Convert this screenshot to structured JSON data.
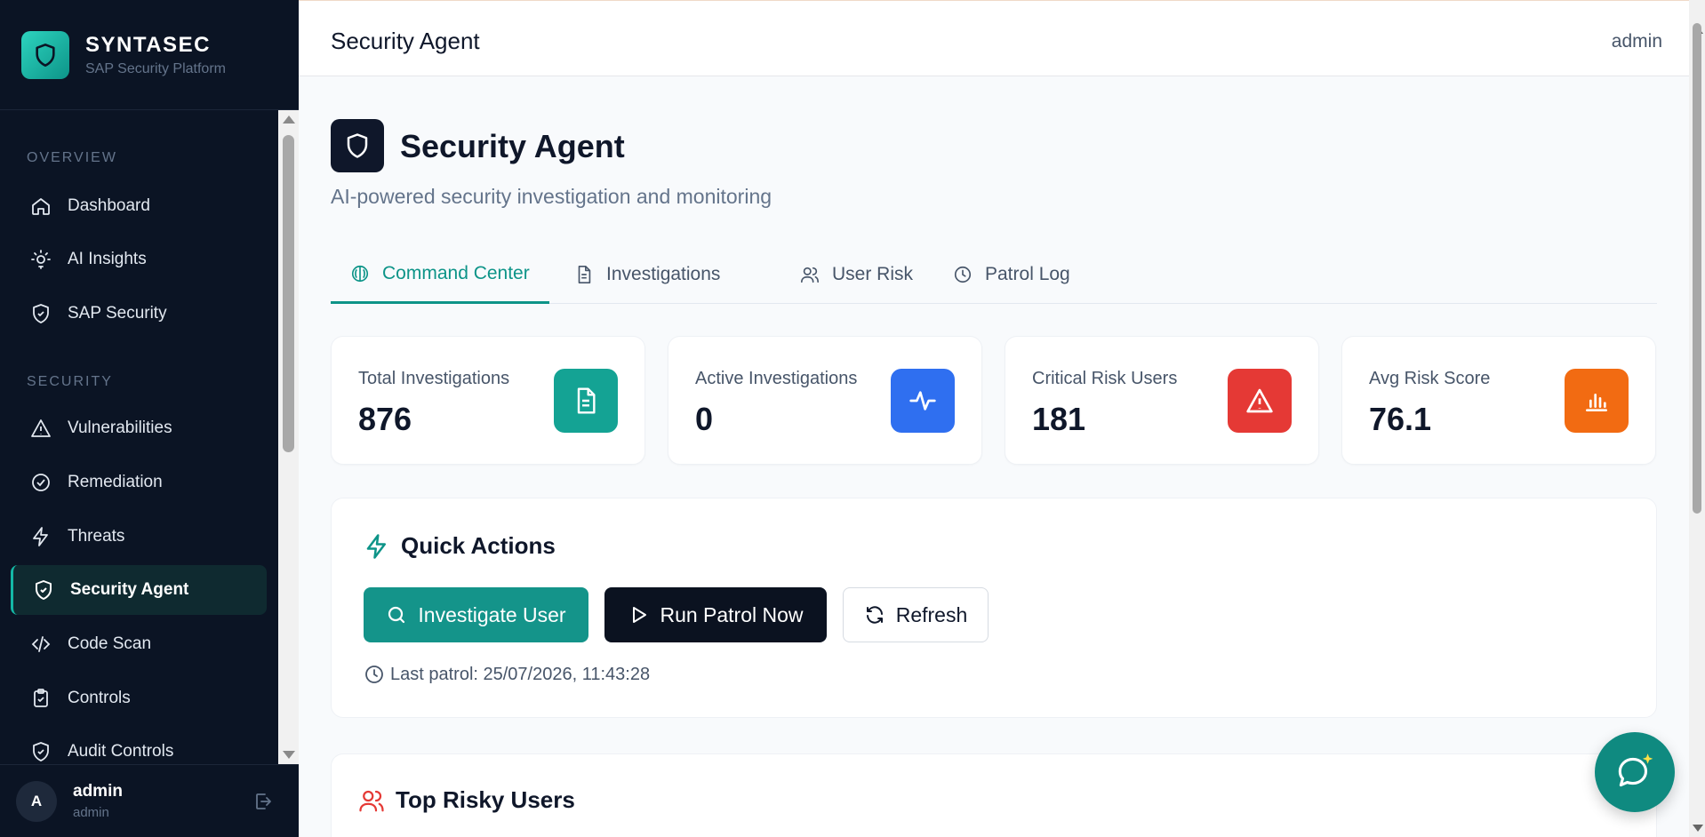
{
  "brand": {
    "name": "SYNTASEC",
    "subtitle": "SAP Security Platform"
  },
  "sidebar": {
    "sections": [
      {
        "title": "OVERVIEW"
      },
      {
        "title": "SECURITY"
      }
    ],
    "items": [
      {
        "label": "Dashboard",
        "icon": "home-icon"
      },
      {
        "label": "AI Insights",
        "icon": "lightbulb-icon"
      },
      {
        "label": "SAP Security",
        "icon": "shield-check-icon"
      },
      {
        "label": "Vulnerabilities",
        "icon": "warning-triangle-icon"
      },
      {
        "label": "Remediation",
        "icon": "check-circle-icon"
      },
      {
        "label": "Threats",
        "icon": "lightning-icon"
      },
      {
        "label": "Security Agent",
        "icon": "shield-check-icon",
        "active": true
      },
      {
        "label": "Code Scan",
        "icon": "code-icon"
      },
      {
        "label": "Controls",
        "icon": "clipboard-check-icon"
      },
      {
        "label": "Audit Controls",
        "icon": "shield-check-icon"
      }
    ],
    "user": {
      "initial": "A",
      "name": "admin",
      "role": "admin"
    }
  },
  "header": {
    "title": "Security Agent",
    "user": "admin"
  },
  "page": {
    "title": "Security Agent",
    "subtitle": "AI-powered security investigation and monitoring"
  },
  "tabs": [
    {
      "label": "Command Center",
      "icon": "brain-icon",
      "active": true
    },
    {
      "label": "Investigations",
      "icon": "document-icon"
    },
    {
      "label": "User Risk",
      "icon": "users-icon"
    },
    {
      "label": "Patrol Log",
      "icon": "clock-icon"
    }
  ],
  "stats": [
    {
      "label": "Total Investigations",
      "value": "876",
      "icon": "document-icon",
      "color": "#14a394"
    },
    {
      "label": "Active Investigations",
      "value": "0",
      "icon": "activity-icon",
      "color": "#2f6ff0"
    },
    {
      "label": "Critical Risk Users",
      "value": "181",
      "icon": "warning-triangle-icon",
      "color": "#e53935"
    },
    {
      "label": "Avg Risk Score",
      "value": "76.1",
      "icon": "bar-chart-icon",
      "color": "#f26b12"
    }
  ],
  "quick_actions": {
    "title": "Quick Actions",
    "buttons": {
      "investigate": "Investigate User",
      "patrol": "Run Patrol Now",
      "refresh": "Refresh"
    },
    "last_patrol": "Last patrol: 25/07/2026, 11:43:28"
  },
  "top_risky": {
    "title": "Top Risky Users"
  }
}
